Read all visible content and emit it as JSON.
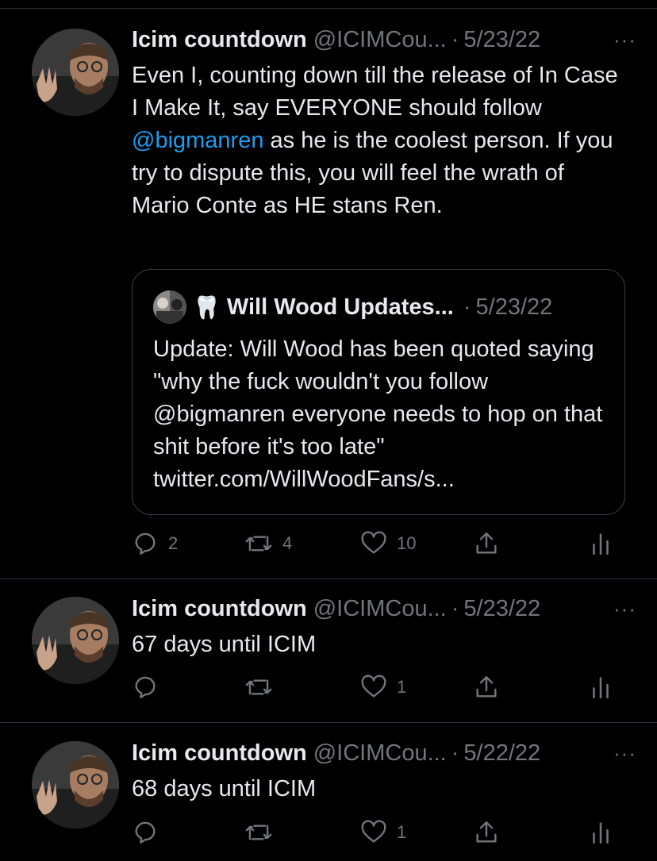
{
  "tweets": [
    {
      "name": "Icim countdown",
      "handle": "@ICIMCou...",
      "date": "5/23/22",
      "more": "···",
      "text_parts": {
        "before": "Even I, counting down till the release of In Case I Make It, say EVERYONE should follow ",
        "mention": "@bigmanren",
        "after": " as he is the coolest person. If you try to dispute this, you will feel the wrath of Mario Conte as HE stans Ren."
      },
      "quote": {
        "emoji": "🦷",
        "name": "Will Wood Updates...",
        "date": "5/23/22",
        "text": "Update: Will Wood has been quoted saying \"why the fuck wouldn't you follow @bigmanren everyone needs to hop on that shit before it's too late\" twitter.com/WillWoodFans/s..."
      },
      "actions": {
        "replies": "2",
        "retweets": "4",
        "likes": "10"
      }
    },
    {
      "name": "Icim countdown",
      "handle": "@ICIMCou...",
      "date": "5/23/22",
      "more": "···",
      "text": "67 days until ICIM",
      "actions": {
        "replies": "",
        "retweets": "",
        "likes": "1"
      }
    },
    {
      "name": "Icim countdown",
      "handle": "@ICIMCou...",
      "date": "5/22/22",
      "more": "···",
      "text": "68 days until ICIM",
      "actions": {
        "replies": "",
        "retweets": "",
        "likes": "1"
      }
    }
  ],
  "icons": {
    "reply": "reply-icon",
    "retweet": "retweet-icon",
    "like": "heart-icon",
    "share": "share-icon",
    "analytics": "analytics-icon",
    "more": "more-icon"
  },
  "colors": {
    "background": "#000000",
    "text": "#e7e9ea",
    "muted": "#71767b",
    "link": "#1d9bf0",
    "divider": "#2f3336"
  }
}
